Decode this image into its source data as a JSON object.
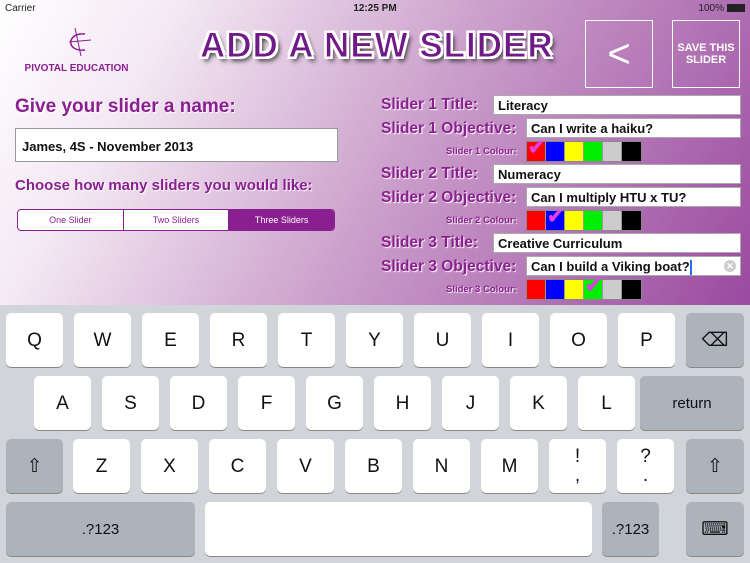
{
  "status": {
    "carrier": "Carrier",
    "time": "12:25 PM",
    "battery": "100%"
  },
  "logo": {
    "text": "PIVOTAL EDUCATION"
  },
  "header": {
    "title": "ADD A NEW SLIDER",
    "back_label": "<",
    "save_label": "SAVE THIS SLIDER"
  },
  "form": {
    "name_label": "Give your slider a name:",
    "name_value": "James, 4S - November 2013",
    "choose_label": "Choose how many sliders you would like:",
    "options": [
      "One Slider",
      "Two Sliders",
      "Three Sliders"
    ],
    "selected": "Three Sliders"
  },
  "colors": [
    "#ff0000",
    "#0000ff",
    "#ffff00",
    "#00ee00",
    "#cccccc",
    "#000000"
  ],
  "sliders": [
    {
      "title_label": "Slider 1 Title:",
      "title": "Literacy",
      "objective_label": "Slider 1 Objective:",
      "objective": "Can I write a haiku?",
      "colour_label": "Slider 1 Colour:",
      "selected_colour": 0
    },
    {
      "title_label": "Slider 2 Title:",
      "title": "Numeracy",
      "objective_label": "Slider 2 Objective:",
      "objective": "Can I multiply HTU x TU?",
      "colour_label": "Slider 2 Colour:",
      "selected_colour": 1
    },
    {
      "title_label": "Slider 3 Title:",
      "title": "Creative Curriculum",
      "objective_label": "Slider 3 Objective:",
      "objective": "Can I build a Viking boat?",
      "colour_label": "Slider 3 Colour:",
      "selected_colour": 3
    }
  ],
  "keyboard": {
    "row1": [
      "Q",
      "W",
      "E",
      "R",
      "T",
      "Y",
      "U",
      "I",
      "O",
      "P"
    ],
    "row2": [
      "A",
      "S",
      "D",
      "F",
      "G",
      "H",
      "J",
      "K",
      "L"
    ],
    "row3": [
      "Z",
      "X",
      "C",
      "V",
      "B",
      "N",
      "M",
      "!\n,",
      "?\n."
    ],
    "return": "return",
    "numbers": ".?123",
    "backspace": "⌫",
    "shift": "⇧",
    "hide": "⌨"
  }
}
